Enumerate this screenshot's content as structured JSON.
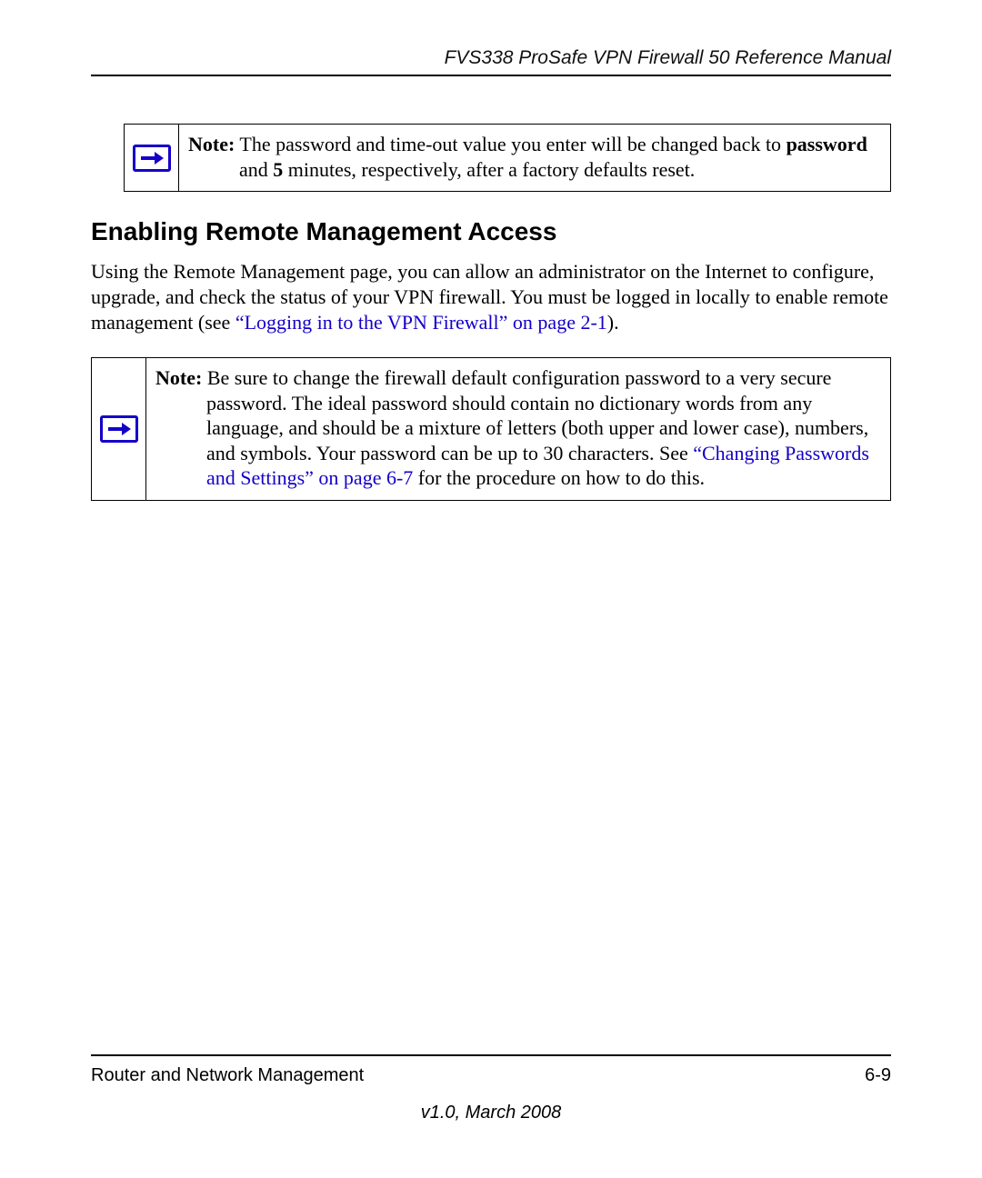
{
  "header": {
    "title": "FVS338 ProSafe VPN Firewall 50 Reference Manual"
  },
  "note1": {
    "label": "Note:",
    "t1": " The password and time-out value you enter will be changed back to ",
    "b1": "password",
    "t2": " and ",
    "b2": "5",
    "t3": " minutes, respectively, after a factory defaults reset."
  },
  "section": {
    "heading": "Enabling Remote Management Access",
    "para_a": "Using the Remote Management page, you can allow an administrator on the Internet to configure, upgrade, and check the status of your VPN firewall. You must be logged in locally to enable remote management (see ",
    "para_link": "“Logging in to the VPN Firewall” on page 2-1",
    "para_b": ")."
  },
  "note2": {
    "label": "Note:",
    "t1": " Be sure to change the firewall default configuration password to a very secure password. The ideal password should contain no dictionary words from any language, and should be a mixture of letters (both upper and lower case), numbers, and symbols. Your password can be up to 30 characters. See ",
    "link": "“Changing Passwords and Settings” on page 6-7",
    "t2": " for the procedure on how to do this."
  },
  "footer": {
    "left": "Router and Network Management",
    "right": "6-9",
    "version": "v1.0, March 2008"
  }
}
